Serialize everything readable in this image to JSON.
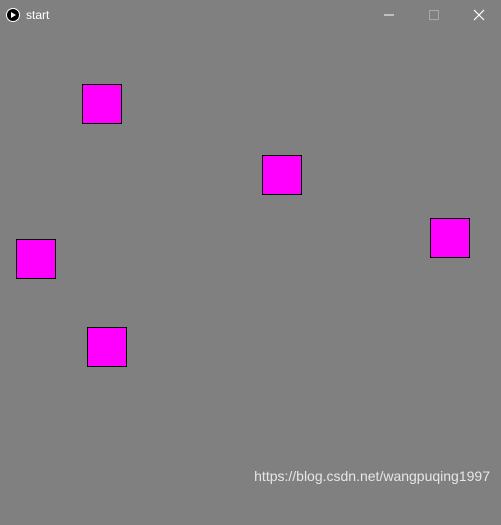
{
  "window": {
    "title": "start",
    "icon": "play-icon",
    "controls": [
      "minimize-icon",
      "maximize-icon",
      "close-icon"
    ]
  },
  "canvas": {
    "background_color": "#808080",
    "square_fill_color": "#ff00ff",
    "square_stroke_color": "#000000",
    "square_count": 5
  },
  "watermark": {
    "text": "https://blog.csdn.net/wangpuqing1997"
  }
}
